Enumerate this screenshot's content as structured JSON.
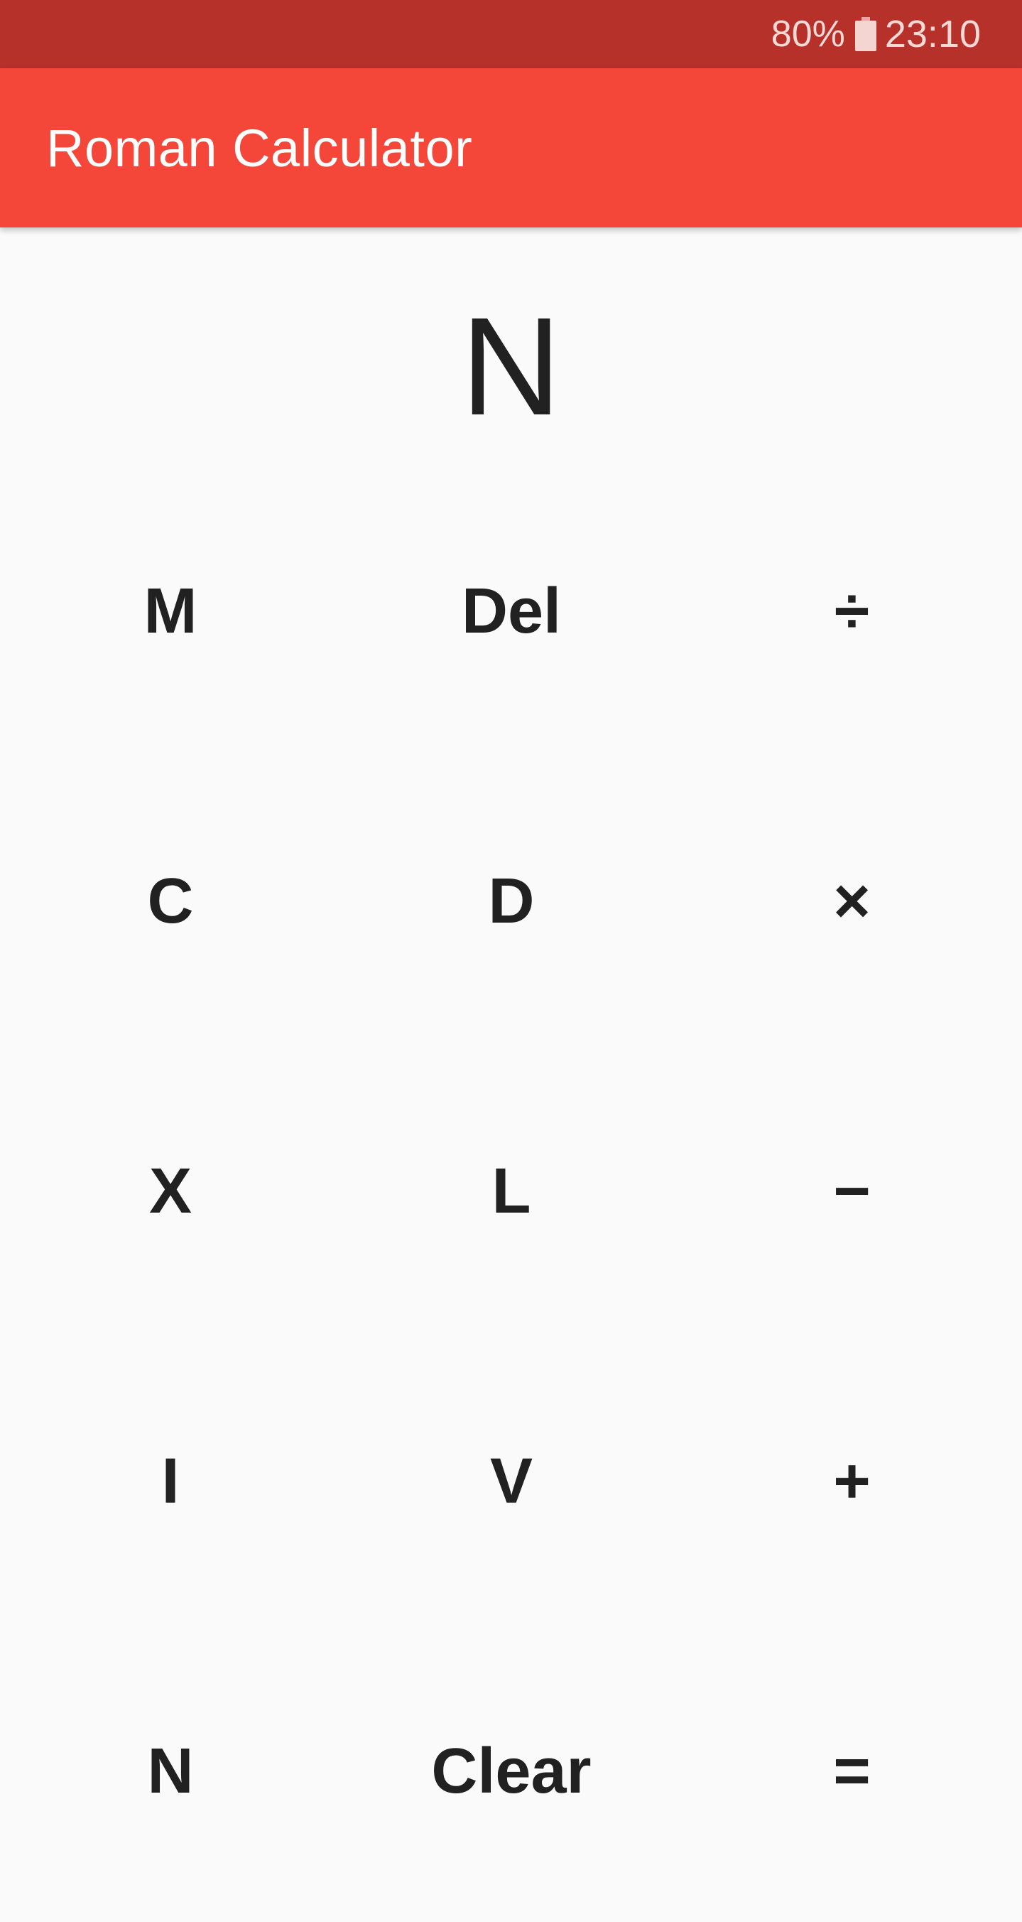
{
  "status_bar": {
    "battery_percent": "80%",
    "time": "23:10",
    "battery_icon": "battery-icon"
  },
  "app_bar": {
    "title": "Roman Calculator"
  },
  "display": {
    "value": "N"
  },
  "keypad": {
    "keys": [
      {
        "label": "M"
      },
      {
        "label": "Del"
      },
      {
        "label": "÷"
      },
      {
        "label": "C"
      },
      {
        "label": "D"
      },
      {
        "label": "×"
      },
      {
        "label": "X"
      },
      {
        "label": "L"
      },
      {
        "label": "−"
      },
      {
        "label": "I"
      },
      {
        "label": "V"
      },
      {
        "label": "+"
      },
      {
        "label": "N"
      },
      {
        "label": "Clear"
      },
      {
        "label": "="
      }
    ]
  }
}
